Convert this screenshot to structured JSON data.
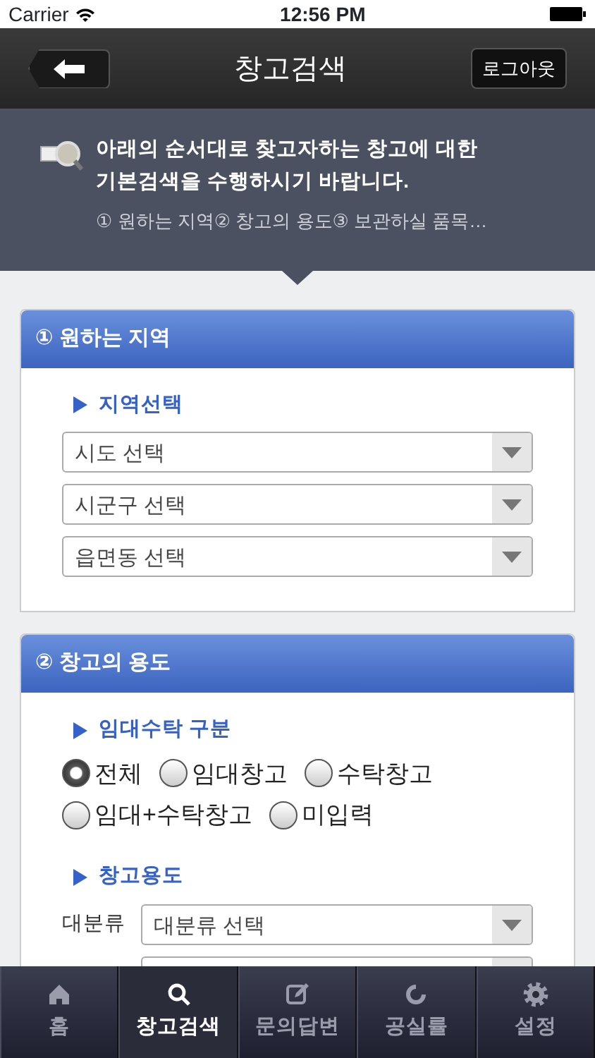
{
  "status_bar": {
    "carrier": "Carrier",
    "time": "12:56 PM"
  },
  "nav_bar": {
    "title": "창고검색",
    "right_button": "로그아웃"
  },
  "intro": {
    "text": "아래의 순서대로 찾고자하는 창고에 대한 기본검색을 수행하시기 바랍니다.",
    "steps": "① 원하는 지역② 창고의 용도③ 보관하실 품목…"
  },
  "sections": [
    {
      "title": "① 원하는 지역",
      "groups": [
        {
          "heading": "지역선택",
          "items": [
            {
              "kind": "select",
              "placeholder": "시도 선택"
            },
            {
              "kind": "select",
              "placeholder": "시군구 선택"
            },
            {
              "kind": "select",
              "placeholder": "읍면동 선택"
            }
          ]
        }
      ]
    },
    {
      "title": "② 창고의 용도",
      "groups": [
        {
          "heading": "임대수탁 구분",
          "items": [
            {
              "kind": "radios",
              "options": [
                {
                  "label": "전체",
                  "selected": true
                },
                {
                  "label": "임대창고",
                  "selected": false
                },
                {
                  "label": "수탁창고",
                  "selected": false
                },
                {
                  "label": "임대+수탁창고",
                  "selected": false
                },
                {
                  "label": "미입력",
                  "selected": false
                }
              ]
            }
          ]
        },
        {
          "heading": "창고용도",
          "items": [
            {
              "kind": "labeled_select",
              "label": "대분류",
              "placeholder": "대분류 선택"
            },
            {
              "kind": "labeled_select"
            }
          ]
        }
      ]
    }
  ],
  "tab_bar": [
    {
      "label": "홈",
      "selected": false
    },
    {
      "label": "창고검색",
      "selected": true
    },
    {
      "label": "문의답변",
      "selected": false
    },
    {
      "label": "공실률",
      "selected": false
    },
    {
      "label": "설정",
      "selected": false
    }
  ]
}
